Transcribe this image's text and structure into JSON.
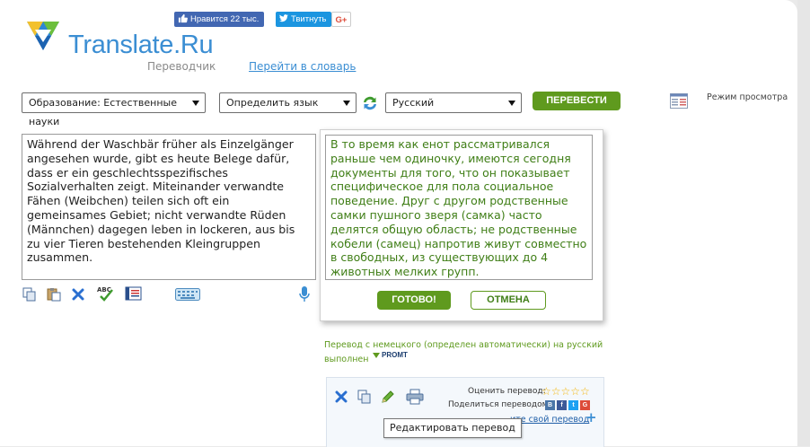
{
  "header": {
    "brand": "Translate.Ru",
    "subtitle": "Переводчик",
    "dictionary_link": "Перейти в словарь",
    "facebook_like": "Нравится 22 тыс.",
    "tweet": "Твитнуть",
    "gplus": "G+"
  },
  "controls": {
    "topic": "Образование: Естественные науки",
    "source_lang": "Определить язык",
    "target_lang": "Русский",
    "translate_button": "ПЕРЕВЕСТИ",
    "view_mode": "Режим просмотра"
  },
  "source": {
    "text": "Während der Waschbär früher als Einzelgänger angesehen wurde, gibt es heute Belege dafür, dass er ein geschlechtsspezifisches Sozialverhalten zeigt. Miteinander verwandte Fähen (Weibchen) teilen sich oft ein gemeinsames Gebiet; nicht verwandte Rüden (Männchen) dagegen leben in lockeren, aus bis zu vier Tieren bestehenden Kleingruppen zusammen."
  },
  "translation": {
    "text": "В то время как енот рассматривался раньше чем одиночку, имеются сегодня документы для того, что он показывает специфическое для пола социальное поведение. Друг с другом родственные самки пушного зверя (самка) часто делятся общую область; не родственные кобели (самец) напротив живут совместно в свободных, из существующих до 4 животных мелких групп.",
    "done_button": "ГОТОВО!",
    "cancel_button": "ОТМЕНА",
    "credit": "Перевод с немецкого (определен автоматически) на русский выполнен",
    "promt": "PROMT"
  },
  "panel": {
    "rate_label": "Оценить перевод:",
    "stars": "☆☆☆☆☆",
    "share_label": "Поделиться переводом",
    "social": [
      "В",
      "f",
      "t",
      "G"
    ],
    "suggest_link": "ите свой перевод"
  },
  "tooltip": {
    "text": "Редактировать перевод"
  },
  "colors": {
    "brand_blue": "#3b8ed3",
    "accent_green": "#5f9a1e",
    "translation_text": "#3f7e16"
  }
}
